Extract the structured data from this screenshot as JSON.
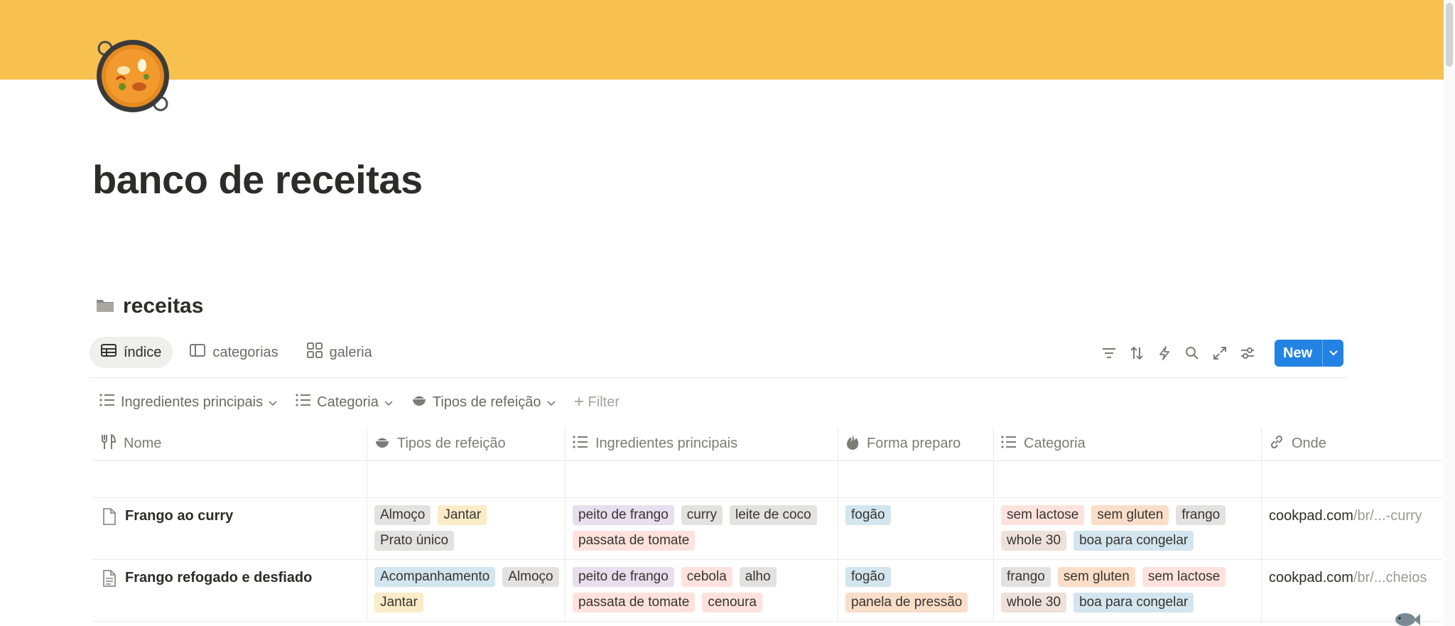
{
  "colors": {
    "cover": "#f8c04f",
    "accent": "#2383e2",
    "tag_gray": "#e3e2e0",
    "tag_yellow": "#fbecc8",
    "tag_purple": "#e8deee",
    "tag_red": "#ffe2dd",
    "tag_blue": "#d3e5ef",
    "tag_brown": "#eee0da",
    "tag_orange": "#fadec9"
  },
  "page": {
    "title": "banco de receitas",
    "icon": "paella-pan-icon"
  },
  "database": {
    "title": "receitas",
    "icon": "folder-icon",
    "views": [
      {
        "label": "índice",
        "icon": "table-icon",
        "active": true
      },
      {
        "label": "categorias",
        "icon": "board-icon",
        "active": false
      },
      {
        "label": "galeria",
        "icon": "gallery-icon",
        "active": false
      }
    ],
    "toolbar": {
      "icons": [
        "filter-icon",
        "sort-icon",
        "automation-icon",
        "search-icon",
        "expand-icon",
        "settings-icon"
      ],
      "new_label": "New"
    },
    "filters": [
      {
        "label": "Ingredientes principais",
        "icon": "list-icon"
      },
      {
        "label": "Categoria",
        "icon": "list-icon"
      },
      {
        "label": "Tipos de refeição",
        "icon": "bowl-icon"
      }
    ],
    "add_filter_label": "Filter",
    "columns": [
      {
        "label": "Nome",
        "icon": "utensils-icon"
      },
      {
        "label": "Tipos de refeição",
        "icon": "bowl-icon"
      },
      {
        "label": "Ingredientes principais",
        "icon": "list-icon"
      },
      {
        "label": "Forma preparo",
        "icon": "fire-icon"
      },
      {
        "label": "Categoria",
        "icon": "list-icon"
      },
      {
        "label": "Onde",
        "icon": "link-icon"
      }
    ],
    "rows": [
      {
        "name": "Frango ao curry",
        "icon": "page-icon",
        "tipos": [
          {
            "text": "Almoço",
            "color": "tag_gray"
          },
          {
            "text": "Jantar",
            "color": "tag_yellow"
          },
          {
            "text": "Prato único",
            "color": "tag_gray"
          }
        ],
        "ingredientes": [
          {
            "text": "peito de frango",
            "color": "tag_purple"
          },
          {
            "text": "curry",
            "color": "tag_gray"
          },
          {
            "text": "leite de coco",
            "color": "tag_gray"
          },
          {
            "text": "passata de tomate",
            "color": "tag_red"
          }
        ],
        "forma": [
          {
            "text": "fogão",
            "color": "tag_blue"
          }
        ],
        "categoria": [
          {
            "text": "sem lactose",
            "color": "tag_red"
          },
          {
            "text": "sem gluten",
            "color": "tag_orange"
          },
          {
            "text": "frango",
            "color": "tag_gray"
          },
          {
            "text": "whole 30",
            "color": "tag_brown"
          },
          {
            "text": "boa para congelar",
            "color": "tag_blue"
          }
        ],
        "onde_domain": "cookpad.com",
        "onde_path": "/br/...-curry"
      },
      {
        "name": "Frango refogado e desfiado",
        "icon": "document-icon",
        "tipos": [
          {
            "text": "Acompanhamento",
            "color": "tag_blue"
          },
          {
            "text": "Almoço",
            "color": "tag_gray"
          },
          {
            "text": "Jantar",
            "color": "tag_yellow"
          }
        ],
        "ingredientes": [
          {
            "text": "peito de frango",
            "color": "tag_purple"
          },
          {
            "text": "cebola",
            "color": "tag_red"
          },
          {
            "text": "alho",
            "color": "tag_gray"
          },
          {
            "text": "passata de tomate",
            "color": "tag_red"
          },
          {
            "text": "cenoura",
            "color": "tag_red"
          }
        ],
        "forma": [
          {
            "text": "fogão",
            "color": "tag_blue"
          },
          {
            "text": "panela de pressão",
            "color": "tag_orange"
          }
        ],
        "categoria": [
          {
            "text": "frango",
            "color": "tag_gray"
          },
          {
            "text": "sem gluten",
            "color": "tag_orange"
          },
          {
            "text": "sem lactose",
            "color": "tag_red"
          },
          {
            "text": "whole 30",
            "color": "tag_brown"
          },
          {
            "text": "boa para congelar",
            "color": "tag_blue"
          }
        ],
        "onde_domain": "cookpad.com",
        "onde_path": "/br/...cheios"
      }
    ]
  }
}
